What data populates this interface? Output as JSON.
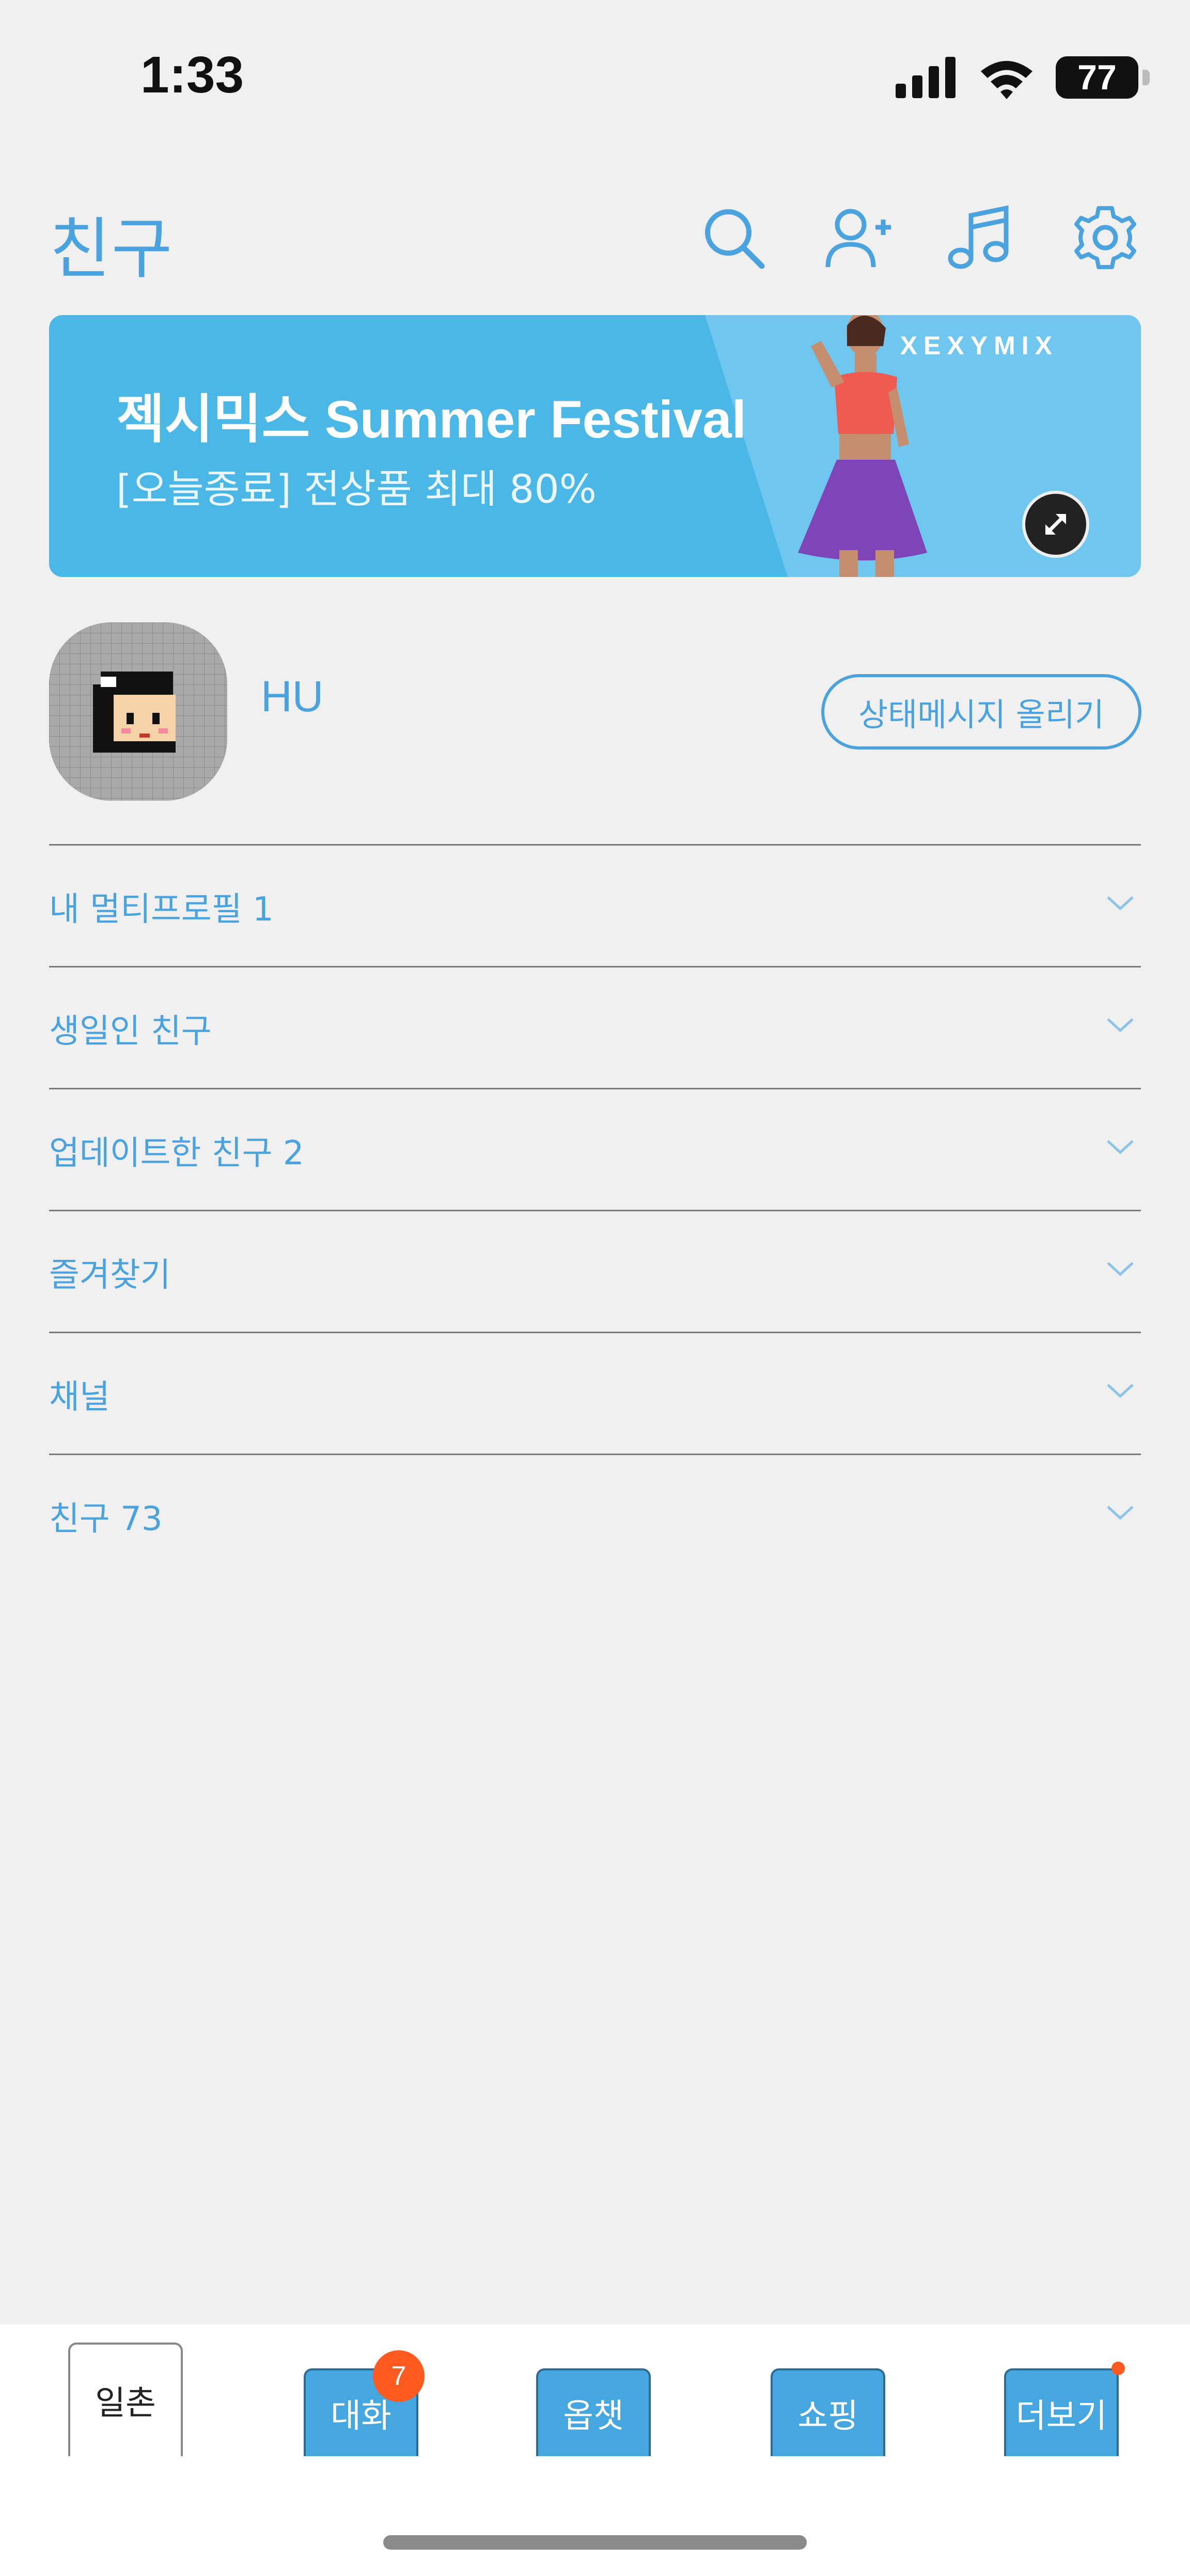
{
  "status_bar": {
    "time": "1:33",
    "battery": "77"
  },
  "header": {
    "title": "친구"
  },
  "banner": {
    "title": "젝시믹스 Summer Festival",
    "subtitle": "[오늘종료] 전상품 최대 80%",
    "brand": "XEXYMIX"
  },
  "profile": {
    "name": "HU",
    "status_button": "상태메시지 올리기"
  },
  "sections": [
    {
      "label": "내 멀티프로필 1"
    },
    {
      "label": "생일인 친구"
    },
    {
      "label": "업데이트한 친구 2"
    },
    {
      "label": "즐겨찾기"
    },
    {
      "label": "채널"
    },
    {
      "label": "친구 73"
    }
  ],
  "tabs": [
    {
      "label": "일촌"
    },
    {
      "label": "대화",
      "badge": "7"
    },
    {
      "label": "옵챗"
    },
    {
      "label": "쇼핑"
    },
    {
      "label": "더보기"
    }
  ],
  "colors": {
    "accent": "#4aa3df",
    "banner": "#4bb7e6",
    "badge": "#ff5a1f"
  },
  "icons": [
    "search-icon",
    "add-friend-icon",
    "music-icon",
    "settings-icon",
    "expand-icon",
    "chevron-down-icon"
  ]
}
